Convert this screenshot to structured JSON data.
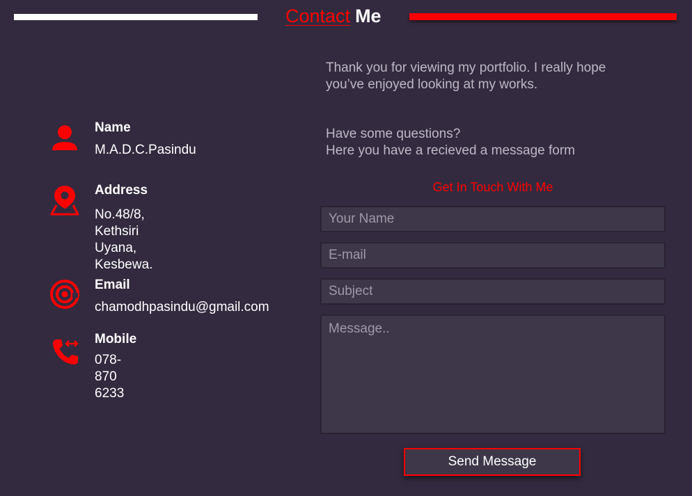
{
  "header": {
    "title_accent": "Contact",
    "title_rest": "Me",
    "accent_color": "#ff0000"
  },
  "contact_info": {
    "name": {
      "label": "Name",
      "value": "M.A.D.C.Pasindu",
      "icon": "person-icon"
    },
    "address": {
      "label": "Address",
      "value": "No.48/8,\nKethsiri Uyana,\nKesbewa.",
      "icon": "location-pin-icon"
    },
    "email": {
      "label": "Email",
      "value": "chamodhpasindu@gmail.com",
      "icon": "at-sign-icon"
    },
    "mobile": {
      "label": "Mobile",
      "value": "078-870 6233",
      "icon": "phone-forward-icon"
    }
  },
  "intro": {
    "text": "Thank you for viewing my portfolio. I really hope\nyou’ve enjoyed looking at my works.",
    "questions": "Have some questions?\nHere you have a recieved a message form"
  },
  "form": {
    "title": "Get In Touch With Me",
    "name_placeholder": "Your Name",
    "email_placeholder": "E-mail",
    "subject_placeholder": "Subject",
    "message_placeholder": "Message..",
    "submit_label": "Send Message"
  },
  "colors": {
    "background": "#332a3f",
    "accent": "#ff0000",
    "field_background": "#3d3749",
    "muted_text": "#bdb8c6"
  }
}
